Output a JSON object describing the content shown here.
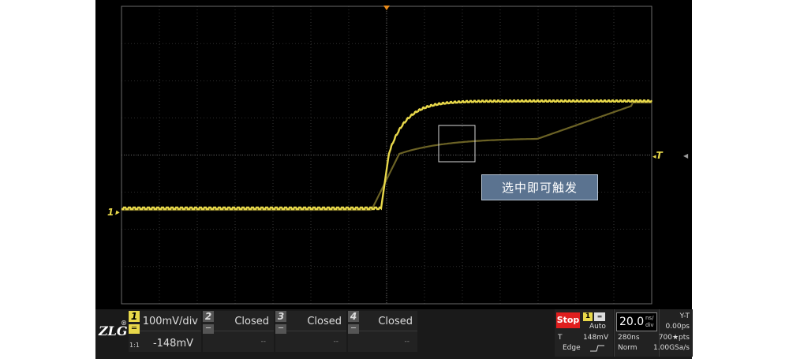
{
  "colors": {
    "trace_active": "#e8d84a",
    "trace_ghost": "#6b6225",
    "grid": "#5a5a5a",
    "stop": "#e01e1e",
    "tooltip": "#5b7390"
  },
  "screen": {
    "trigger_label": "T",
    "channel_marker": "1",
    "tooltip": "选中即可触发"
  },
  "status": {
    "logo": "ZLG",
    "logo_mark": "®",
    "channels": [
      {
        "num": "1",
        "scale": "100mV/div",
        "offset": "-148mV",
        "ratio": "1:1",
        "coupling": "═"
      },
      {
        "num": "2",
        "scale": "Closed",
        "offset": "--",
        "coupling": "─"
      },
      {
        "num": "3",
        "scale": "Closed",
        "offset": "--",
        "coupling": "─"
      },
      {
        "num": "4",
        "scale": "Closed",
        "offset": "--",
        "coupling": "─"
      }
    ],
    "run_state": "Stop",
    "trigger": {
      "source": "1",
      "mode": "Auto",
      "level_label": "T",
      "level": "148mV",
      "type": "Edge"
    },
    "timebase": {
      "value": "20.0",
      "unit_top": "ns/",
      "unit_bottom": "div",
      "position": "280ns",
      "mode": "Norm"
    },
    "display": {
      "mode": "Y-T",
      "delay": "0.00ps",
      "points": "700★pts",
      "rate": "1.00GSa/s"
    }
  }
}
